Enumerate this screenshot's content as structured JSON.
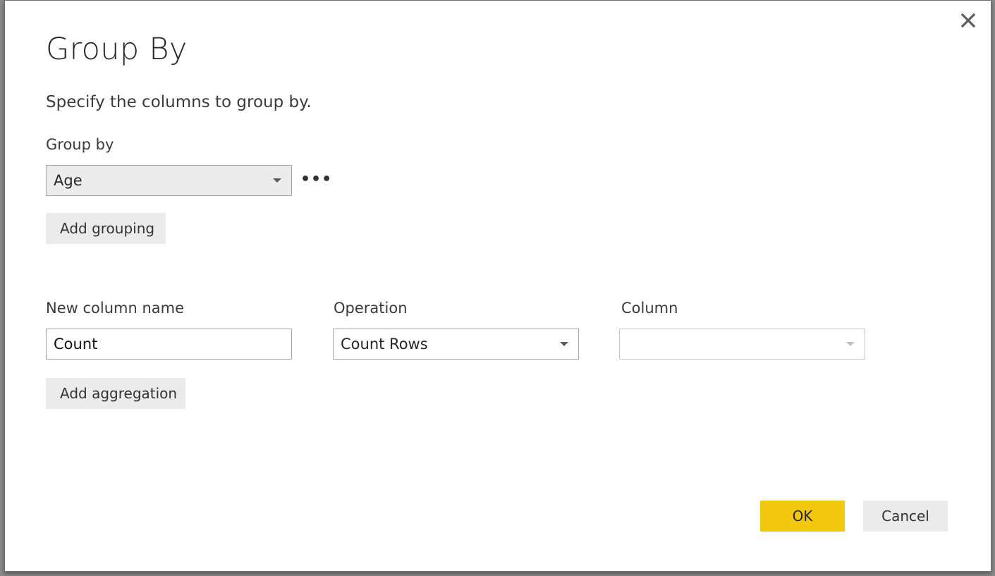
{
  "dialog": {
    "title": "Group By",
    "subtitle": "Specify the columns to group by.",
    "close_icon": "close-icon"
  },
  "grouping": {
    "label": "Group by",
    "selected": "Age",
    "more_options": "•••",
    "add_grouping_label": "Add grouping"
  },
  "aggregation": {
    "new_column_label": "New column name",
    "new_column_value": "Count",
    "operation_label": "Operation",
    "operation_selected": "Count Rows",
    "column_label": "Column",
    "column_selected": "",
    "add_aggregation_label": "Add aggregation"
  },
  "footer": {
    "ok_label": "OK",
    "cancel_label": "Cancel"
  },
  "colors": {
    "primary_button": "#f2c80f",
    "secondary_button": "#ebebeb",
    "filled_select": "#ececec"
  }
}
